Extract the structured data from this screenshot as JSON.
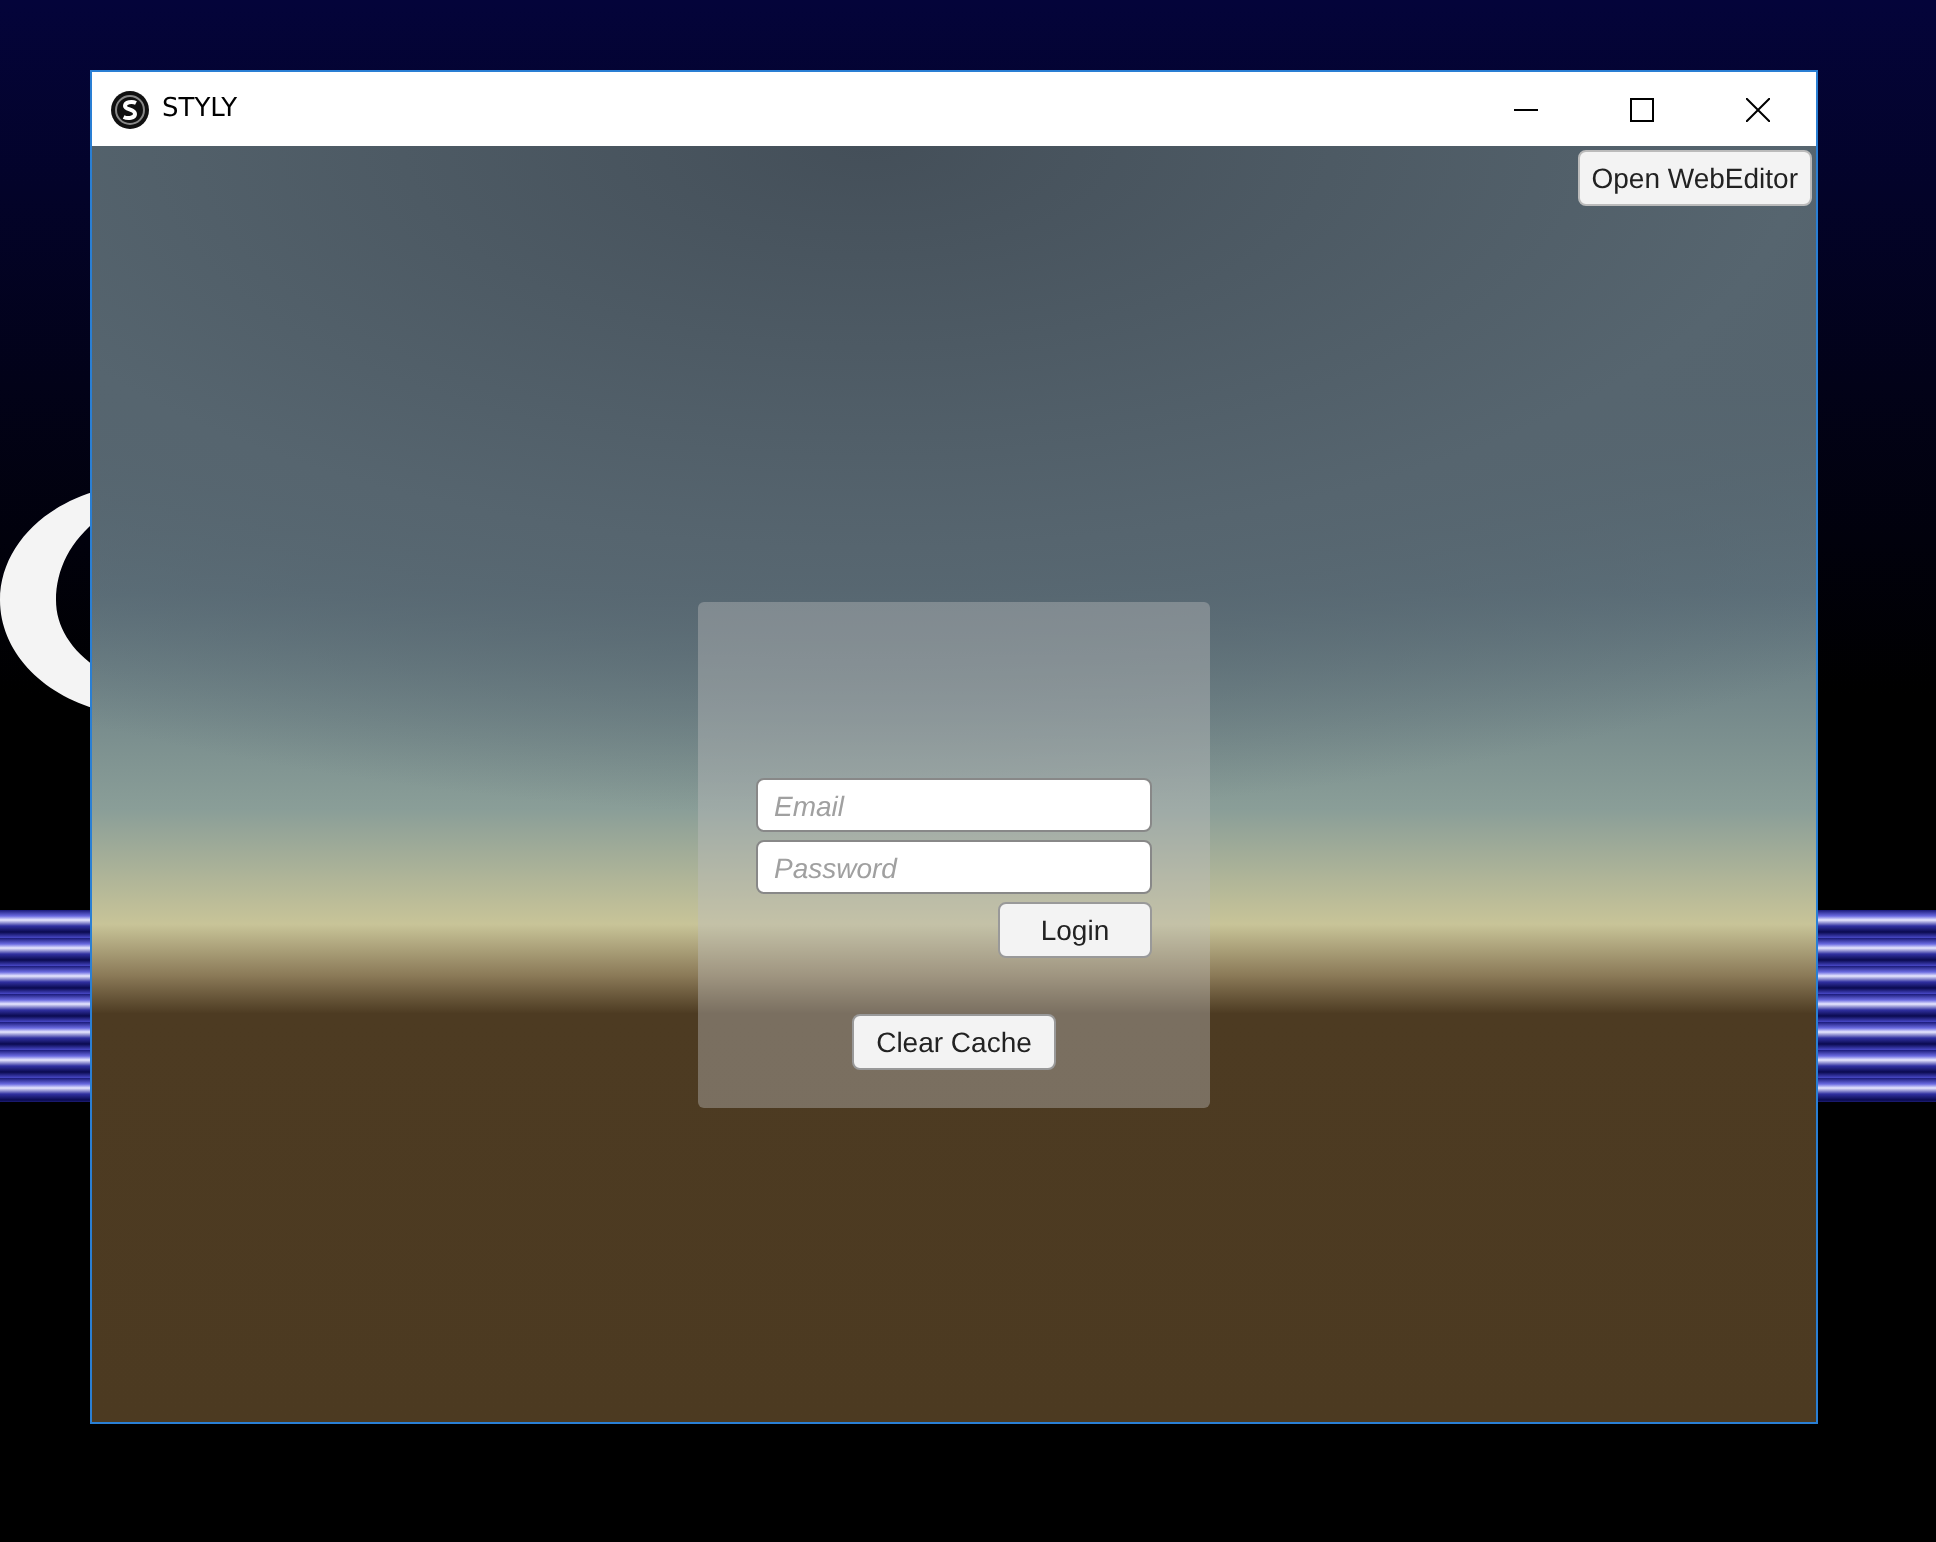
{
  "window": {
    "title": "STYLY"
  },
  "toolbar": {
    "open_web_editor": "Open WebEditor"
  },
  "login_panel": {
    "email": {
      "placeholder": "Email"
    },
    "password": {
      "placeholder": "Password"
    },
    "login_button": "Login",
    "clear_cache_button": "Clear Cache"
  }
}
